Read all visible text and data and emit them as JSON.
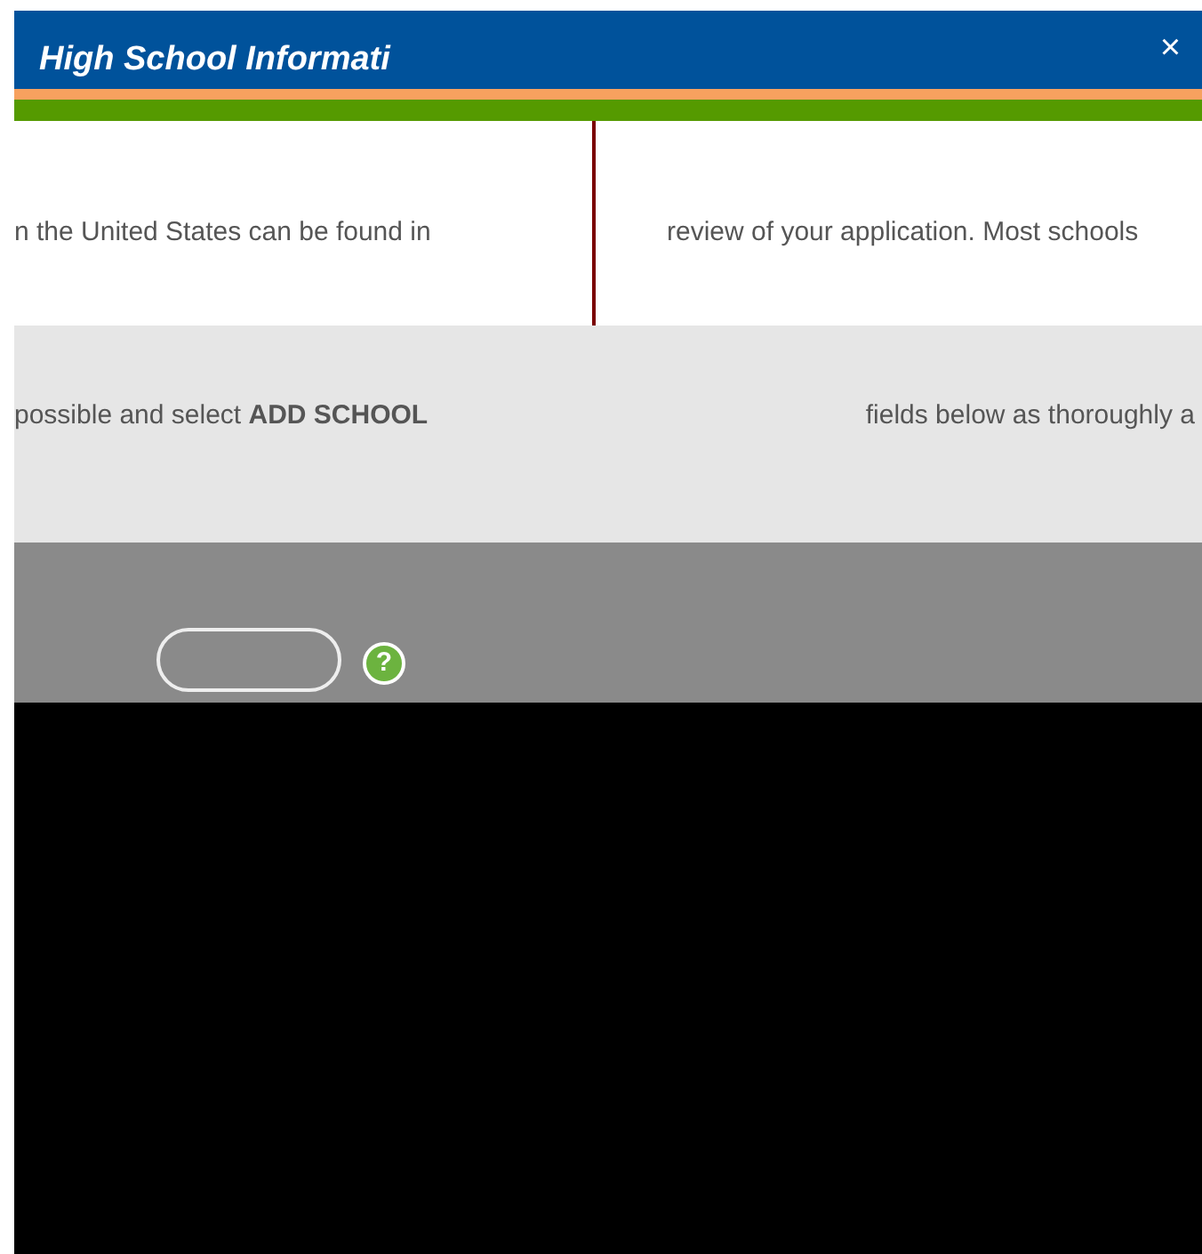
{
  "header": {
    "title": "High School Informati",
    "close": "×"
  },
  "columns": [
    {
      "text": "n the United States can be found in"
    },
    {
      "text": "review of your application. Most schools"
    }
  ],
  "instructions": [
    {
      "text": "possible and select **ADD SCHOOL**"
    },
    {
      "text": "fields below as thoroughly a"
    }
  ],
  "help": {
    "label": "?"
  }
}
